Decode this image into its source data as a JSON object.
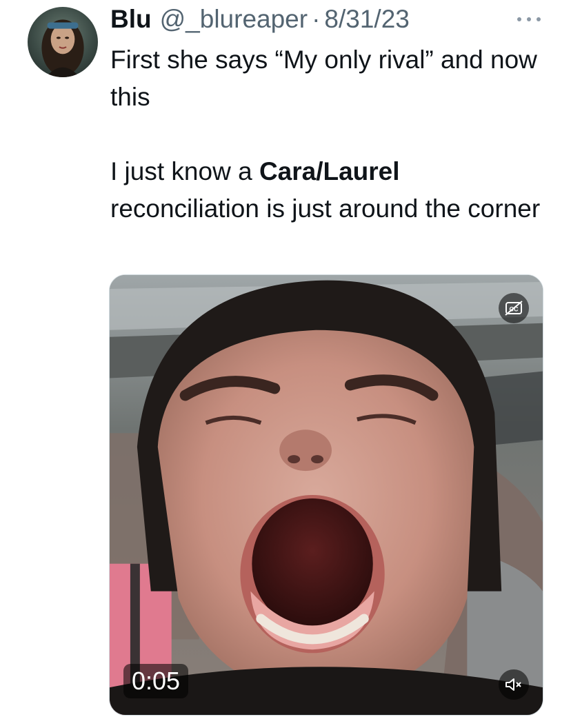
{
  "author": {
    "name": "Blu",
    "handle": "@_blureaper",
    "separator": "·",
    "date": "8/31/23",
    "avatar_icon": "profile-avatar"
  },
  "tweet": {
    "line1": "First she says “My only rival” and now this",
    "line2_prefix": "I just know a ",
    "line2_bold": "Cara/Laurel",
    "line2_suffix": " reconciliation is just around the corner"
  },
  "media": {
    "type": "video",
    "timestamp": "0:05",
    "captions_icon": "captions-off-icon",
    "mute_icon": "volume-muted-icon"
  },
  "colors": {
    "text": "#0f1419",
    "secondary": "#536471",
    "border": "#cfd9de"
  }
}
